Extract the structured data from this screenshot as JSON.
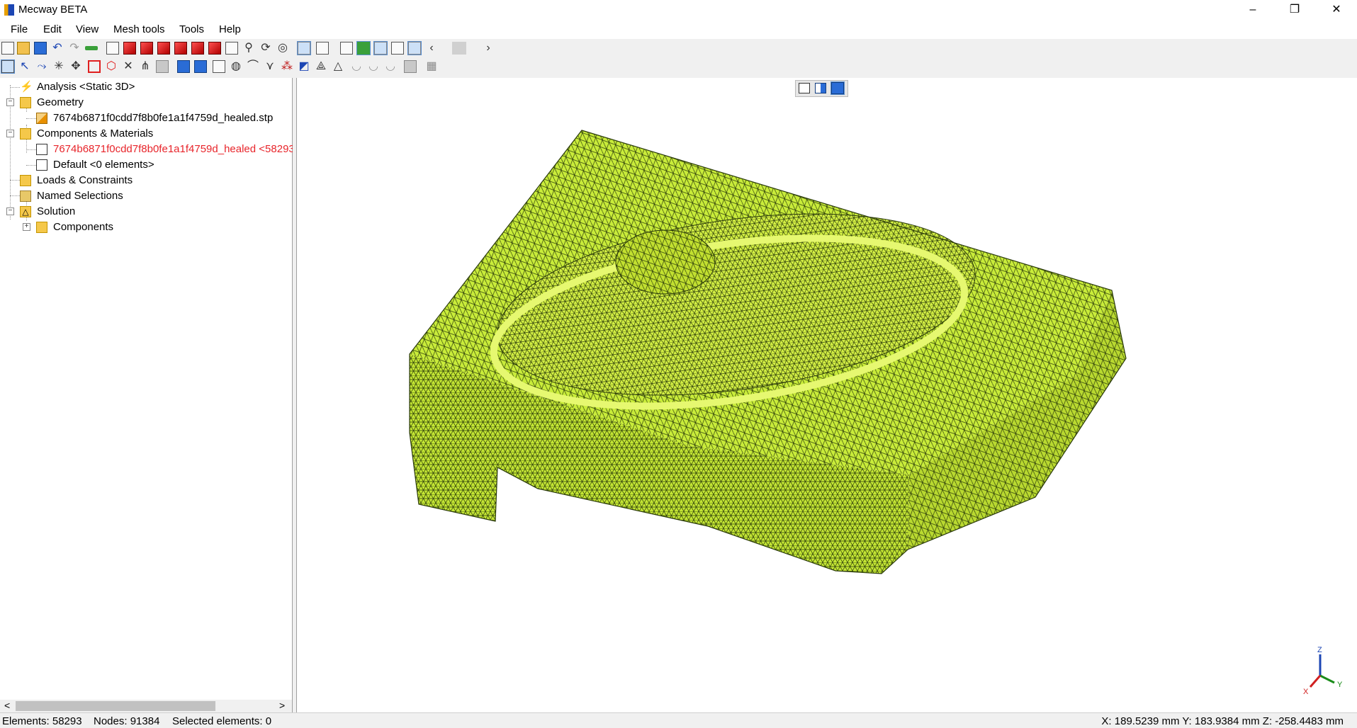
{
  "window": {
    "title": "Mecway BETA",
    "controls": {
      "minimize": "–",
      "maximize": "❐",
      "close": "✕"
    }
  },
  "menu": [
    "File",
    "Edit",
    "View",
    "Mesh tools",
    "Tools",
    "Help"
  ],
  "toolbar_icons": {
    "row1": [
      "new-file-icon",
      "open-file-icon",
      "save-icon",
      "undo-icon",
      "redo-icon",
      "green-bar-icon",
      "view-iso-icon",
      "view-front-icon",
      "view-back-icon",
      "view-left-icon",
      "view-right-icon",
      "view-top-icon",
      "view-bottom-icon",
      "zoom-window-icon",
      "zoom-icon",
      "rotate-icon",
      "fit-icon",
      "render-mode-icon",
      "display-options-icon",
      "edges-icon",
      "shaded-icon",
      "transparent-icon",
      "wireframe-icon",
      "mesh-quality-icon",
      "scroll-left-icon",
      "scroll-thumb",
      "scroll-right-icon"
    ],
    "row2": [
      "select-elements-icon",
      "select-nodes-icon",
      "select-path-icon",
      "explode-icon",
      "move-nodes-icon",
      "rectangle-icon",
      "cube-icon",
      "delete-icon",
      "split-icon",
      "extrude-icon",
      "renumber-icon",
      "refine-icon",
      "copy-icon",
      "cylinder-icon",
      "bend-icon",
      "merge-icon",
      "connect-icon",
      "solution-icon",
      "mesh-triangle-icon",
      "triangle-icon",
      "surface-1-icon",
      "surface-2-icon",
      "surface-3-icon",
      "grid-icon",
      "table-icon"
    ]
  },
  "tree": {
    "analysis": "Analysis <Static 3D>",
    "geometry": "Geometry",
    "geometry_file": "7674b6871f0cdd7f8b0fe1a1f4759d_healed.stp",
    "components_materials": "Components & Materials",
    "component_main": "7674b6871f0cdd7f8b0fe1a1f4759d_healed <58293",
    "component_default": "Default <0 elements>",
    "loads_constraints": "Loads & Constraints",
    "named_selections": "Named Selections",
    "solution": "Solution",
    "solution_components": "Components"
  },
  "tree_scroll": {
    "left": "<",
    "right": ">"
  },
  "viewport": {
    "mesh_color": "#c9ec3a",
    "mesh_line_color": "#2a3a0a",
    "triad": {
      "x": "X",
      "y": "Y",
      "z": "Z"
    }
  },
  "status": {
    "elements": "Elements: 58293",
    "nodes": "Nodes: 91384",
    "selected": "Selected elements: 0",
    "coords": "X: 189.5239 mm Y: 183.9384 mm Z: -258.4483 mm"
  },
  "colors": {
    "tree_red": "#e8252b",
    "accent_blue": "#2a6cd6"
  }
}
